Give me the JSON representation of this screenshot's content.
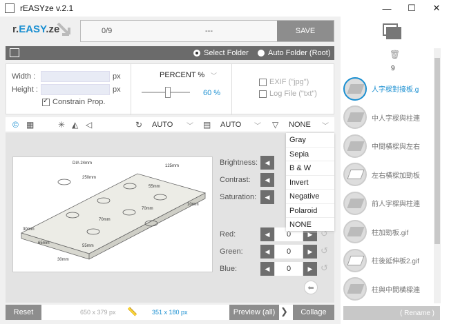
{
  "app": {
    "title": "rEASYze v.2.1"
  },
  "window": {
    "minimize": "—",
    "maximize": "☐",
    "close": "✕"
  },
  "logo": {
    "prefix": "r.",
    "accent": "EASY",
    "suffix": ".ze"
  },
  "topbar": {
    "count": "0/9",
    "status": "---",
    "save_label": "SAVE"
  },
  "folder": {
    "select_label": "Select Folder",
    "auto_label": "Auto Folder (Root)",
    "selected": "Select Folder"
  },
  "size": {
    "width_label": "Width :",
    "height_label": "Height :",
    "width_value": "",
    "height_value": "",
    "unit": "px",
    "constrain_label": "Constrain Prop.",
    "constrain_checked": true,
    "mode_label": "PERCENT %",
    "percent_value": "60 %"
  },
  "log": {
    "exif_label": "EXIF (\"jpg\")",
    "logfile_label": "Log File (\"txt\")"
  },
  "toolbar": {
    "rotate_value": "AUTO",
    "format_value": "AUTO",
    "filter_value": "NONE"
  },
  "adjust": {
    "brightness_label": "Brightness:",
    "contrast_label": "Contrast:",
    "saturation_label": "Saturation:",
    "red_label": "Red:",
    "green_label": "Green:",
    "blue_label": "Blue:",
    "red_value": "0",
    "green_value": "0",
    "blue_value": "0"
  },
  "filter_options": [
    "Gray",
    "Sepia",
    "B & W",
    "Invert",
    "Negative",
    "Polaroid",
    "NONE"
  ],
  "drawing": {
    "labels": [
      "DIA 24mm",
      "125mm",
      "250mm",
      "55mm",
      "10mm",
      "70mm",
      "70mm",
      "30mm",
      "65mm",
      "55mm",
      "30mm"
    ]
  },
  "bottom": {
    "reset_label": "Reset",
    "original_size": "650 x 379 px",
    "new_size": "351 x 180 px",
    "preview_label": "Preview (all)",
    "collage_label": "Collage"
  },
  "sidebar": {
    "file_count": "9",
    "rename_label": "( Rename )",
    "files": [
      {
        "name": "人字樑對接板.g",
        "selected": true
      },
      {
        "name": "中人字樑與柱連",
        "selected": false
      },
      {
        "name": "中間橫樑與左右",
        "selected": false
      },
      {
        "name": "左右橫樑加勁板",
        "selected": false
      },
      {
        "name": "前人字樑與柱連",
        "selected": false
      },
      {
        "name": "柱加勁板.gif",
        "selected": false
      },
      {
        "name": "柱後延伸板2.gif",
        "selected": false
      },
      {
        "name": "柱與中間橫樑連",
        "selected": false
      }
    ]
  },
  "colors": {
    "accent": "#1a8fd1",
    "dark_strip": "#6b6b6b",
    "button": "#8d8d8d"
  }
}
